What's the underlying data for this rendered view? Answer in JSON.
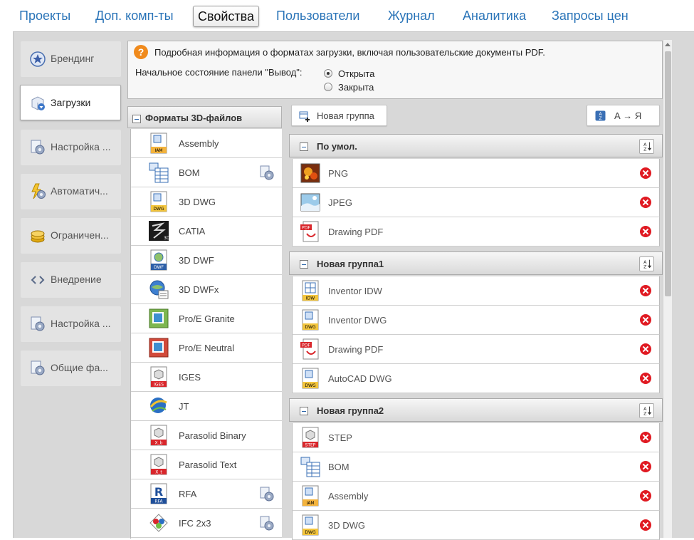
{
  "nav": {
    "tabs": [
      {
        "label": "Проекты"
      },
      {
        "label": "Доп. комп-ты"
      },
      {
        "label": "Свойства"
      },
      {
        "label": "Пользователи"
      },
      {
        "label": "Журнал"
      },
      {
        "label": "Аналитика"
      },
      {
        "label": "Запросы цен"
      }
    ],
    "active": "Свойства"
  },
  "sidebar": {
    "items": [
      {
        "label": "Брендинг",
        "icon": "star-badge-icon"
      },
      {
        "label": "Загрузки",
        "icon": "download-cube-icon",
        "active": true
      },
      {
        "label": "Настройка ...",
        "icon": "settings-doc-icon"
      },
      {
        "label": "Автоматич...",
        "icon": "automation-gear-icon"
      },
      {
        "label": "Ограничен...",
        "icon": "coins-icon"
      },
      {
        "label": "Внедрение",
        "icon": "embed-code-icon"
      },
      {
        "label": "Настройка ...",
        "icon": "settings-doc-icon"
      },
      {
        "label": "Общие фа...",
        "icon": "settings-doc-icon"
      }
    ]
  },
  "info": {
    "help_text": "Подробная информация о форматах загрузки, включая пользовательские документы PDF.",
    "panel_label": "Начальное состояние панели \"Вывод\":",
    "options": [
      {
        "label": "Открыта",
        "selected": true
      },
      {
        "label": "Закрыта",
        "selected": false
      }
    ]
  },
  "formats": {
    "title": "Форматы 3D-файлов",
    "items": [
      {
        "label": "Assembly",
        "icon": "assembly-iam-icon",
        "gear": false
      },
      {
        "label": "BOM",
        "icon": "bom-table-icon",
        "gear": true
      },
      {
        "label": "3D DWG",
        "icon": "dwg-file-icon",
        "gear": false
      },
      {
        "label": "CATIA",
        "icon": "catia-logo-icon",
        "gear": false
      },
      {
        "label": "3D DWF",
        "icon": "dwf-file-icon",
        "gear": false
      },
      {
        "label": "3D DWFx",
        "icon": "dwfx-globe-icon",
        "gear": false
      },
      {
        "label": "Pro/E Granite",
        "icon": "proe-granite-icon",
        "gear": false
      },
      {
        "label": "Pro/E Neutral",
        "icon": "proe-neutral-icon",
        "gear": false
      },
      {
        "label": "IGES",
        "icon": "iges-file-icon",
        "gear": false
      },
      {
        "label": "JT",
        "icon": "jt-globe-icon",
        "gear": false
      },
      {
        "label": "Parasolid Binary",
        "icon": "parasolid-binary-icon",
        "gear": false
      },
      {
        "label": "Parasolid Text",
        "icon": "parasolid-text-icon",
        "gear": false
      },
      {
        "label": "RFA",
        "icon": "rfa-revit-icon",
        "gear": true
      },
      {
        "label": "IFC 2x3",
        "icon": "ifc-icon",
        "gear": true
      }
    ]
  },
  "toolbar": {
    "new_group": "Новая группа",
    "sort_label": "А → Я"
  },
  "groups": [
    {
      "title": "По умол.",
      "items": [
        {
          "label": "PNG",
          "icon": "png-image-icon"
        },
        {
          "label": "JPEG",
          "icon": "jpeg-image-icon"
        },
        {
          "label": "Drawing PDF",
          "icon": "pdf-file-icon"
        }
      ]
    },
    {
      "title": "Новая группа1",
      "items": [
        {
          "label": "Inventor IDW",
          "icon": "idw-file-icon"
        },
        {
          "label": "Inventor DWG",
          "icon": "dwg-file-icon"
        },
        {
          "label": "Drawing PDF",
          "icon": "pdf-file-icon"
        },
        {
          "label": "AutoCAD DWG",
          "icon": "dwg-file-icon"
        }
      ]
    },
    {
      "title": "Новая группа2",
      "items": [
        {
          "label": "STEP",
          "icon": "step-file-icon"
        },
        {
          "label": "BOM",
          "icon": "bom-table-icon"
        },
        {
          "label": "Assembly",
          "icon": "assembly-iam-icon"
        },
        {
          "label": "3D DWG",
          "icon": "dwg-file-icon"
        }
      ]
    }
  ]
}
